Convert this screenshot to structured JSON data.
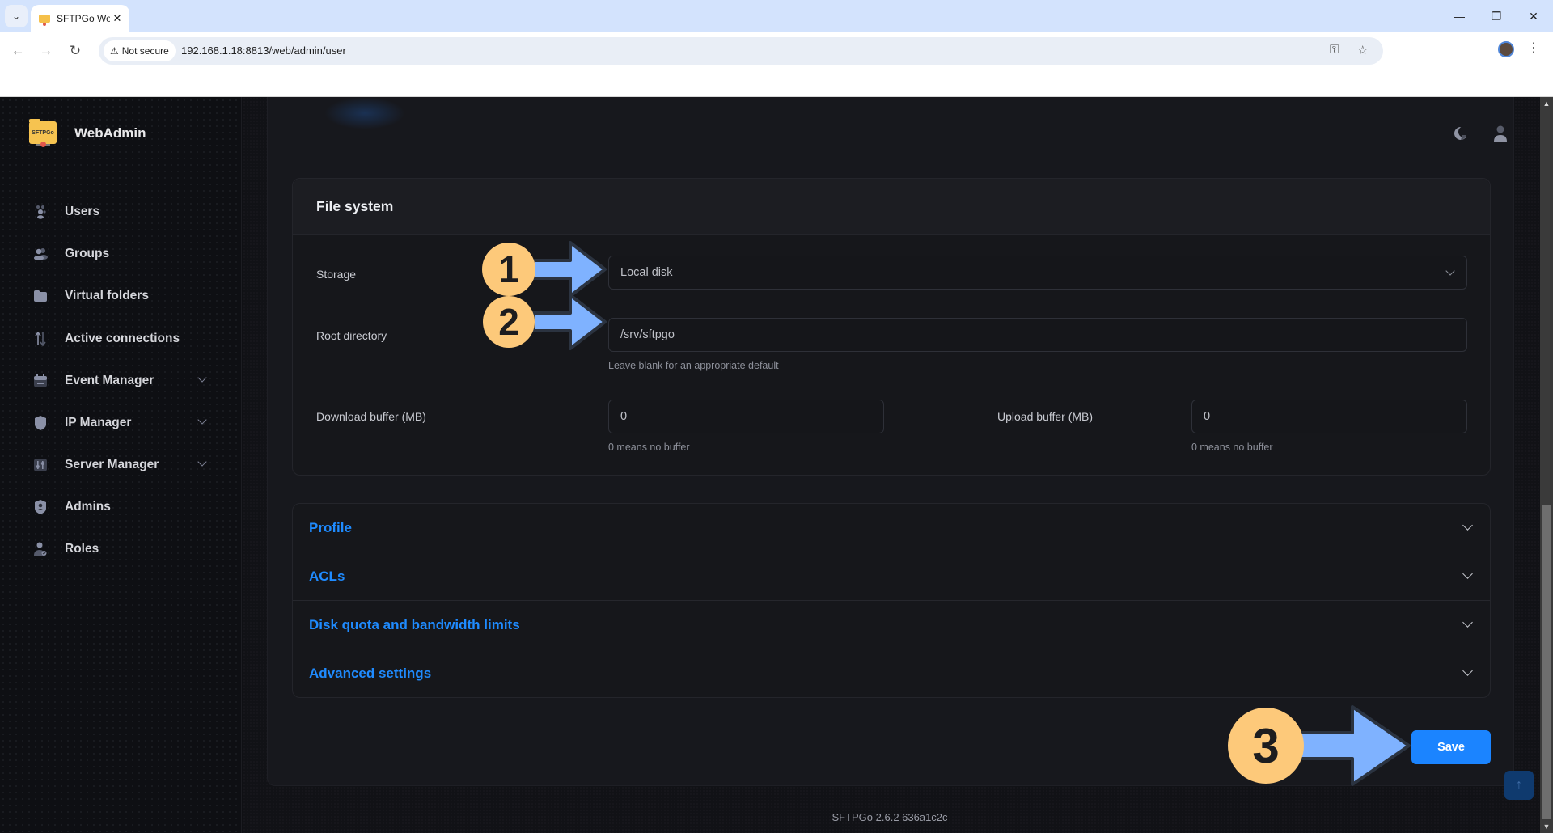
{
  "browser": {
    "tab_title": "SFTPGo WebAdmin",
    "tab_close": "✕",
    "not_secure_label": "Not secure",
    "url": "192.168.1.18:8813/web/admin/user",
    "window_controls": {
      "minimize": "—",
      "restore": "❐",
      "close": "✕"
    },
    "nav": {
      "back": "←",
      "forward": "→",
      "reload": "↻"
    }
  },
  "sidebar": {
    "brand": "WebAdmin",
    "logo_text": "SFTPGo",
    "items": [
      {
        "label": "Users",
        "icon": "users-icon",
        "expandable": false
      },
      {
        "label": "Groups",
        "icon": "groups-icon",
        "expandable": false
      },
      {
        "label": "Virtual folders",
        "icon": "folder-icon",
        "expandable": false
      },
      {
        "label": "Active connections",
        "icon": "arrows-up-down-icon",
        "expandable": false
      },
      {
        "label": "Event Manager",
        "icon": "calendar-icon",
        "expandable": true
      },
      {
        "label": "IP Manager",
        "icon": "shield-icon",
        "expandable": true
      },
      {
        "label": "Server Manager",
        "icon": "sliders-icon",
        "expandable": true
      },
      {
        "label": "Admins",
        "icon": "admin-shield-icon",
        "expandable": false
      },
      {
        "label": "Roles",
        "icon": "user-check-icon",
        "expandable": false
      }
    ]
  },
  "header": {
    "theme_toggle_icon": "moon-icon",
    "user_menu_icon": "user-icon"
  },
  "file_system": {
    "title": "File system",
    "storage": {
      "label": "Storage",
      "value": "Local disk"
    },
    "root_directory": {
      "label": "Root directory",
      "value": "/srv/sftpgo",
      "help": "Leave blank for an appropriate default"
    },
    "download_buffer": {
      "label": "Download buffer (MB)",
      "value": "0",
      "help": "0 means no buffer"
    },
    "upload_buffer": {
      "label": "Upload buffer (MB)",
      "value": "0",
      "help": "0 means no buffer"
    }
  },
  "accordion": [
    {
      "label": "Profile"
    },
    {
      "label": "ACLs"
    },
    {
      "label": "Disk quota and bandwidth limits"
    },
    {
      "label": "Advanced settings"
    }
  ],
  "actions": {
    "save_label": "Save"
  },
  "footer": {
    "version": "SFTPGo 2.6.2 636a1c2c"
  },
  "annotations": [
    {
      "number": "1",
      "target": "storage-select"
    },
    {
      "number": "2",
      "target": "root-directory-input"
    },
    {
      "number": "3",
      "target": "save-button"
    }
  ],
  "colors": {
    "accent": "#1b84ff",
    "link": "#1f8bff",
    "badge": "#fdc97a",
    "arrow_fill": "#7fb2ff",
    "arrow_stroke": "#2b3340"
  }
}
